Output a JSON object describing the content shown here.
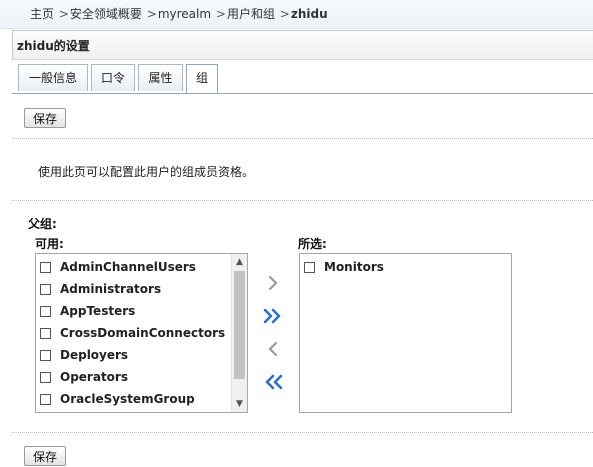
{
  "breadcrumb": {
    "items": [
      "主页",
      "安全领域概要",
      "myrealm",
      "用户和组"
    ],
    "current": "zhidu"
  },
  "section_title": "zhidu的设置",
  "tabs": [
    {
      "label": "一般信息"
    },
    {
      "label": "口令"
    },
    {
      "label": "属性"
    },
    {
      "label": "组",
      "active": true
    }
  ],
  "save_label": "保存",
  "description": "使用此页可以配置此用户的组成员资格。",
  "parent_groups_label": "父组:",
  "available_label": "可用:",
  "chosen_label": "所选:",
  "available_groups": [
    "AdminChannelUsers",
    "Administrators",
    "AppTesters",
    "CrossDomainConnectors",
    "Deployers",
    "Operators",
    "OracleSystemGroup"
  ],
  "chosen_groups": [
    "Monitors"
  ],
  "colors": {
    "arrow_active": "#2d6fc9",
    "arrow_inactive": "#9a9a9a",
    "tab_border": "#8fa6bb"
  }
}
